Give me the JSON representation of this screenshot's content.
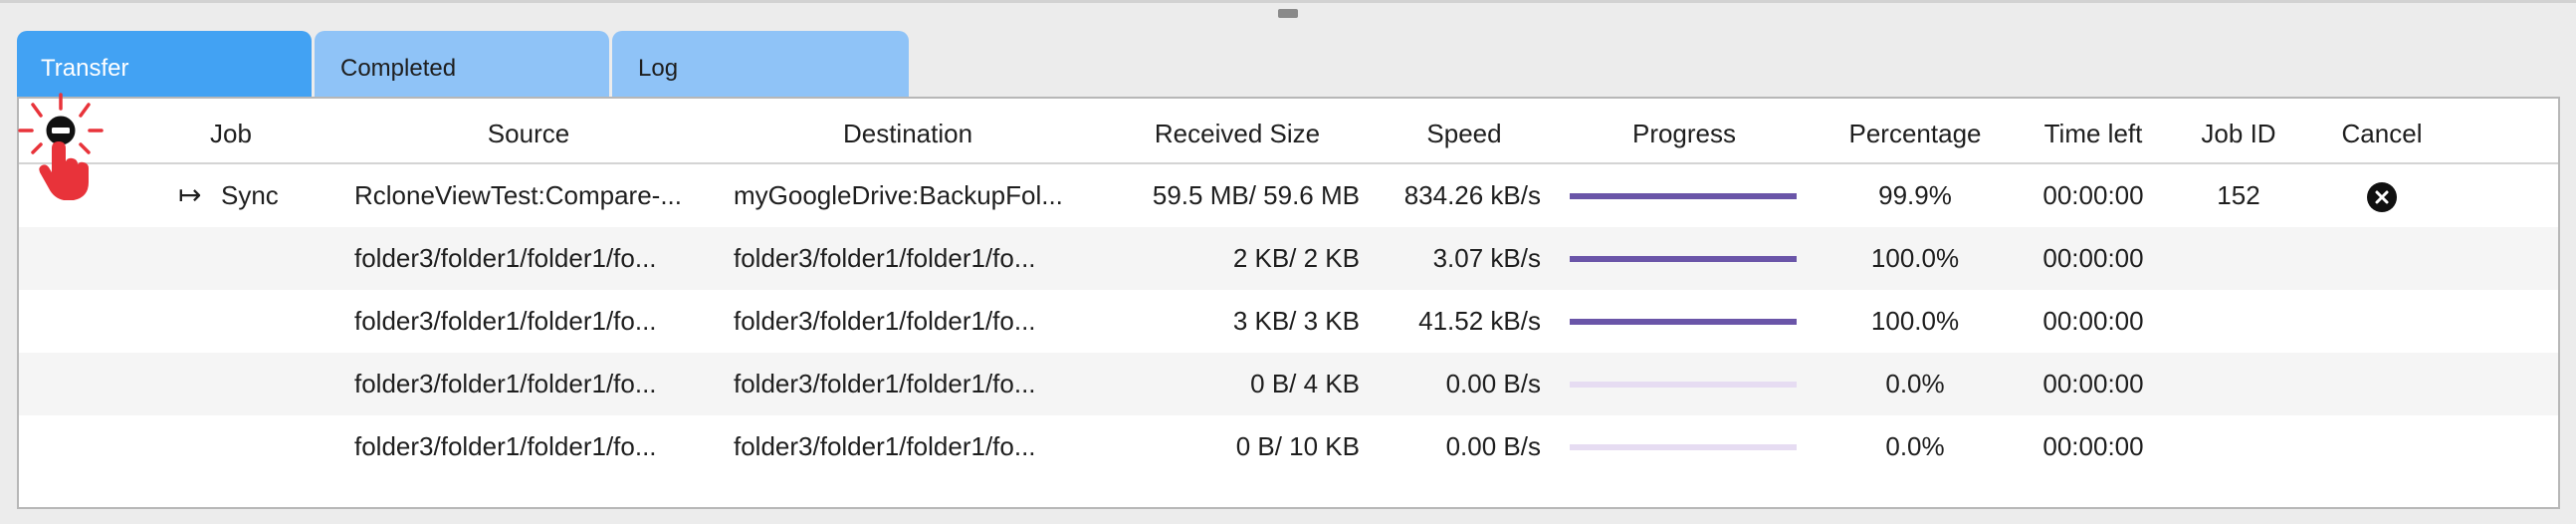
{
  "tabs": [
    {
      "label": "Transfer",
      "active": true
    },
    {
      "label": "Completed",
      "active": false
    },
    {
      "label": "Log",
      "active": false
    }
  ],
  "columns": {
    "job": "Job",
    "source": "Source",
    "destination": "Destination",
    "received_size": "Received Size",
    "speed": "Speed",
    "progress": "Progress",
    "percentage": "Percentage",
    "time_left": "Time left",
    "job_id": "Job ID",
    "cancel": "Cancel"
  },
  "rows": [
    {
      "job": "Sync",
      "job_icon": "arrow-to-bar-icon",
      "source": "RcloneViewTest:Compare-...",
      "destination": "myGoogleDrive:BackupFol...",
      "received_size": "59.5 MB/ 59.6 MB",
      "speed": "834.26 kB/s",
      "progress": 0.999,
      "percentage": "99.9%",
      "time_left": "00:00:00",
      "job_id": "152",
      "cancel_icon": "close-circle-icon"
    },
    {
      "job": "",
      "source": "folder3/folder1/folder1/fo...",
      "destination": "folder3/folder1/folder1/fo...",
      "received_size": "2 KB/ 2 KB",
      "speed": "3.07 kB/s",
      "progress": 1.0,
      "percentage": "100.0%",
      "time_left": "00:00:00",
      "job_id": ""
    },
    {
      "job": "",
      "source": "folder3/folder1/folder1/fo...",
      "destination": "folder3/folder1/folder1/fo...",
      "received_size": "3 KB/ 3 KB",
      "speed": "41.52 kB/s",
      "progress": 1.0,
      "percentage": "100.0%",
      "time_left": "00:00:00",
      "job_id": ""
    },
    {
      "job": "",
      "source": "folder3/folder1/folder1/fo...",
      "destination": "folder3/folder1/folder1/fo...",
      "received_size": "0 B/ 4 KB",
      "speed": "0.00 B/s",
      "progress": 0.0,
      "percentage": "0.0%",
      "time_left": "00:00:00",
      "job_id": ""
    },
    {
      "job": "",
      "source": "folder3/folder1/folder1/fo...",
      "destination": "folder3/folder1/folder1/fo...",
      "received_size": "0 B/ 10 KB",
      "speed": "0.00 B/s",
      "progress": 0.0,
      "percentage": "0.0%",
      "time_left": "00:00:00",
      "job_id": ""
    }
  ],
  "colors": {
    "tab_active": "#42a2f3",
    "tab_inactive": "#8fc3f7",
    "progress_fill": "#6a55a8",
    "progress_track": "#e6dcf2",
    "pointer_red": "#e8333a"
  },
  "icons": {
    "pointer": "click-pointer-icon",
    "collapse": "collapse-minus-icon",
    "drag_handle": "drag-handle-icon"
  }
}
